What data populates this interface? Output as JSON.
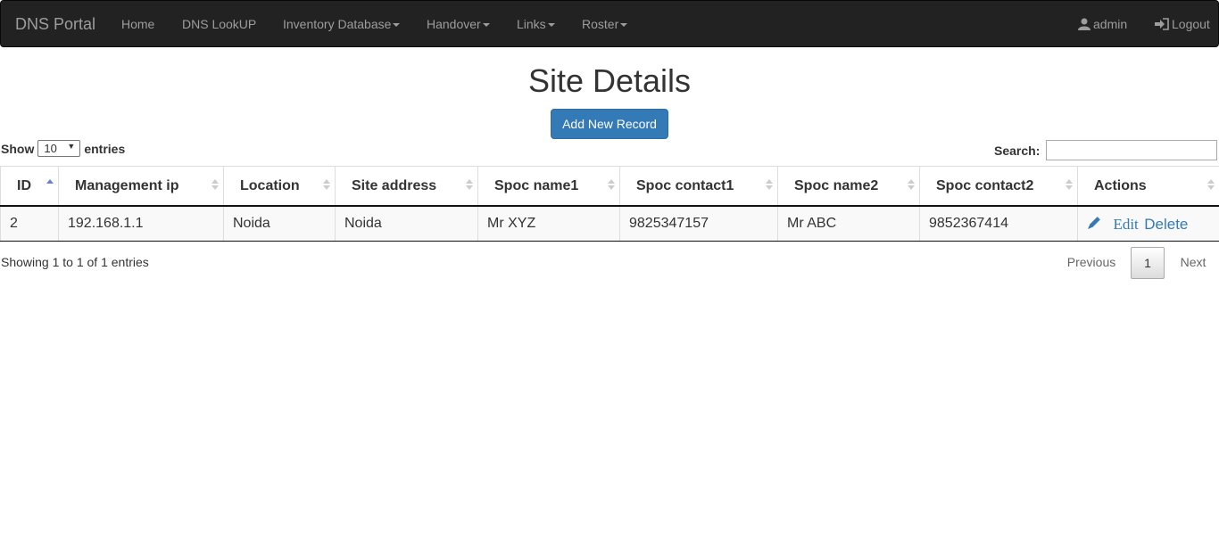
{
  "navbar": {
    "brand": "DNS Portal",
    "items": [
      {
        "label": "Home"
      },
      {
        "label": "DNS LookUP"
      },
      {
        "label": "Inventory Database"
      },
      {
        "label": "Handover"
      },
      {
        "label": "Links"
      },
      {
        "label": "Roster"
      }
    ],
    "user_label": "admin",
    "logout_label": "Logout"
  },
  "page": {
    "title": "Site Details",
    "add_button": "Add New Record"
  },
  "table_controls": {
    "show_label": "Show",
    "page_size": "10",
    "entries_label": "entries",
    "search_label": "Search:",
    "search_value": ""
  },
  "table": {
    "columns": [
      "ID",
      "Management ip",
      "Location",
      "Site address",
      "Spoc name1",
      "Spoc contact1",
      "Spoc name2",
      "Spoc contact2",
      "Actions"
    ],
    "sorted_column": "ID",
    "sort_direction": "asc",
    "rows": [
      {
        "cells": [
          "2",
          "192.168.1.1",
          "Noida",
          "Noida",
          "Mr XYZ",
          "9825347157",
          "Mr ABC",
          "9852367414"
        ],
        "edit_label": "Edit",
        "delete_label": "Delete"
      }
    ]
  },
  "footer": {
    "info": "Showing 1 to 1 of 1 entries",
    "previous_label": "Previous",
    "current_page": "1",
    "next_label": "Next"
  },
  "colors": {
    "navbar_bg": "#222222",
    "primary": "#337ab7",
    "sort_active": "#6b82cf"
  },
  "icons": [
    "user-icon",
    "logout-icon",
    "pencil-icon",
    "sort-icon"
  ]
}
